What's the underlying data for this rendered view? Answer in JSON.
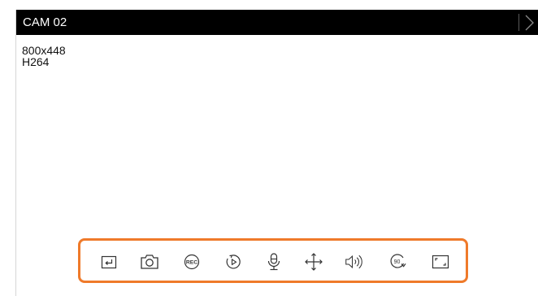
{
  "window": {
    "title": "CAM 02"
  },
  "stream": {
    "resolution": "800x448",
    "codec": "H264"
  },
  "toolbar": {
    "highlight_color": "#ef7a2a",
    "rec_badge": "REC",
    "rotate_badge": "90",
    "tools": [
      {
        "name": "exit-button",
        "icon": "return-icon"
      },
      {
        "name": "snapshot-button",
        "icon": "camera-icon"
      },
      {
        "name": "record-button",
        "icon": "rec-icon"
      },
      {
        "name": "instant-playback-button",
        "icon": "playback-icon"
      },
      {
        "name": "microphone-button",
        "icon": "microphone-icon"
      },
      {
        "name": "ptz-button",
        "icon": "move-arrows-icon"
      },
      {
        "name": "audio-button",
        "icon": "speaker-icon"
      },
      {
        "name": "rotate-button",
        "icon": "rotate-90-icon"
      },
      {
        "name": "fullscreen-button",
        "icon": "fullscreen-icon"
      }
    ]
  }
}
